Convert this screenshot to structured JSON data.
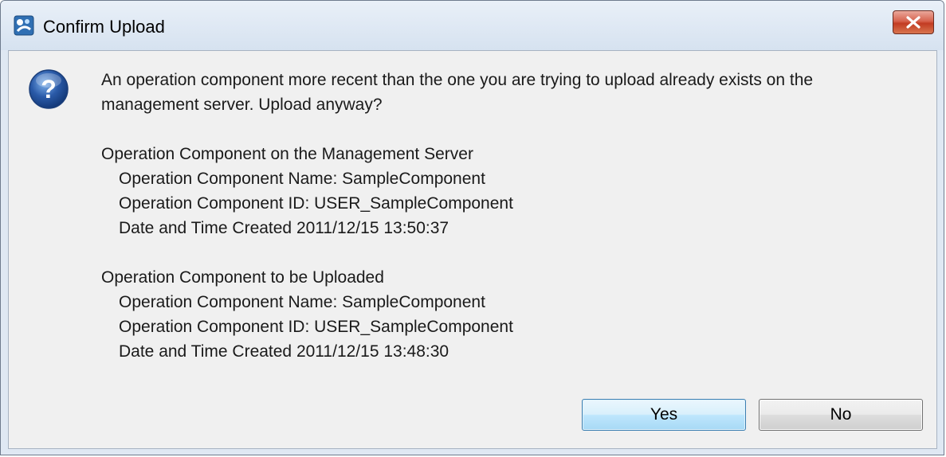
{
  "window": {
    "title": "Confirm Upload"
  },
  "icons": {
    "app": "app-icon",
    "close": "close-icon",
    "question": "question-icon"
  },
  "message": {
    "intro_line1": "An operation component more recent than the one you are trying to upload already exists on the",
    "intro_line2": "management server. Upload anyway?",
    "server": {
      "heading": "Operation Component on the Management Server",
      "name": "Operation Component Name: SampleComponent",
      "id": "Operation Component ID: USER_SampleComponent",
      "created": "Date and Time Created 2011/12/15 13:50:37"
    },
    "upload": {
      "heading": "Operation Component to be Uploaded",
      "name": "Operation Component Name: SampleComponent",
      "id": "Operation Component ID: USER_SampleComponent",
      "created": "Date and Time Created 2011/12/15 13:48:30"
    }
  },
  "buttons": {
    "yes_label": "Yes",
    "no_label": "No"
  },
  "colors": {
    "close_button": "#c23b22",
    "question_icon": "#2a5aa8",
    "dialog_background": "#f0f0f0"
  }
}
